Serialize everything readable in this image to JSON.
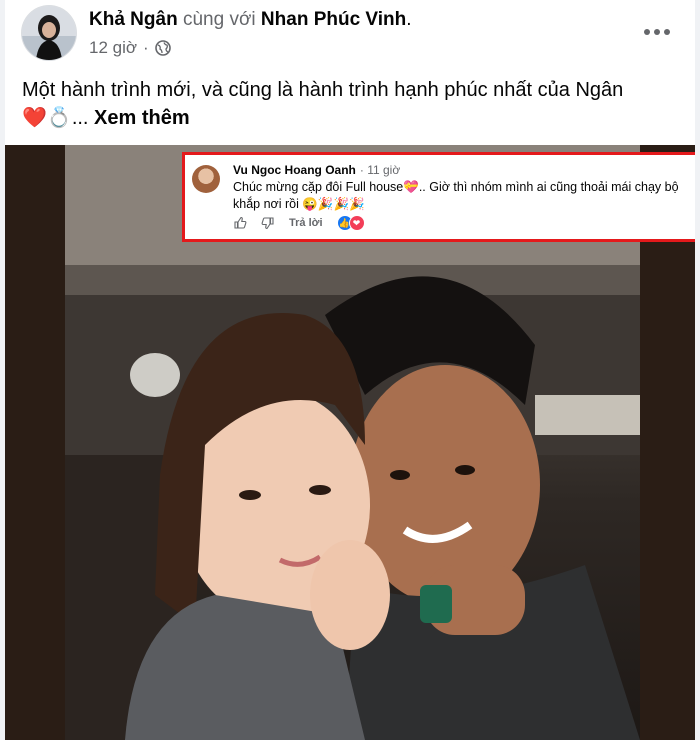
{
  "post": {
    "author": "Khả Ngân",
    "with_text": "cùng với",
    "tagged": "Nhan Phúc Vinh",
    "tagged_suffix": ".",
    "time": "12 giờ",
    "separator": "·",
    "privacy_icon": "globe-icon",
    "text": "Một hành trình mới, và cũng là hành trình hạnh phúc nhất của Ngân",
    "emojis": "❤️💍",
    "ellipsis": "... ",
    "see_more": "Xem thêm"
  },
  "comment": {
    "name": "Vu Ngoc Hoang Oanh",
    "time": "· 11 giờ",
    "text": "Chúc mừng cặp đôi Full house💝.. Giờ thì nhóm mình ai cũng thoải mái chạy bộ khắp nơi rồi 😜🎉🎉🎉",
    "reply": "Trả lời",
    "reactions": [
      "like",
      "love"
    ]
  },
  "colors": {
    "highlight_border": "#e4191b",
    "secondary_text": "#65676b",
    "like_blue": "#1877f2",
    "love_red": "#f33e58"
  }
}
